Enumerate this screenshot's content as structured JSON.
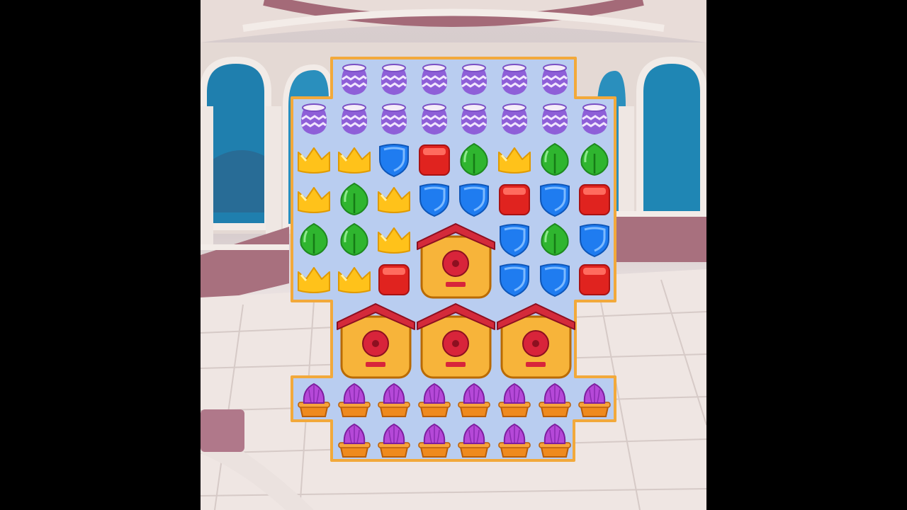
{
  "game": {
    "board": {
      "columns": 8,
      "rows": 10,
      "grid": [
        [
          "none",
          "vase",
          "vase",
          "vase",
          "vase",
          "vase",
          "vase",
          "none"
        ],
        [
          "vase",
          "vase",
          "vase",
          "vase",
          "vase",
          "vase",
          "vase",
          "vase"
        ],
        [
          "crown",
          "crown",
          "shield",
          "cube",
          "leaf",
          "crown",
          "leaf",
          "leaf"
        ],
        [
          "crown",
          "leaf",
          "crown",
          "shield",
          "shield",
          "cube",
          "shield",
          "cube"
        ],
        [
          "leaf",
          "leaf",
          "crown",
          "house",
          "house",
          "shield",
          "leaf",
          "shield"
        ],
        [
          "crown",
          "crown",
          "cube",
          "house",
          "house",
          "shield",
          "shield",
          "cube"
        ],
        [
          "none",
          "house",
          "house",
          "house",
          "house",
          "house",
          "house",
          "none"
        ],
        [
          "none",
          "house",
          "house",
          "house",
          "house",
          "house",
          "house",
          "none"
        ],
        [
          "flower",
          "flower",
          "flower",
          "flower",
          "flower",
          "flower",
          "flower",
          "flower"
        ],
        [
          "none",
          "flower",
          "flower",
          "flower",
          "flower",
          "flower",
          "flower",
          "none"
        ]
      ],
      "big_blockers": [
        {
          "type": "birdhouse",
          "row": 4,
          "col": 3
        },
        {
          "type": "birdhouse",
          "row": 6,
          "col": 1
        },
        {
          "type": "birdhouse",
          "row": 6,
          "col": 3
        },
        {
          "type": "birdhouse",
          "row": 6,
          "col": 5
        }
      ]
    },
    "colors": {
      "board_border": "#f2a93b",
      "board_fill": "#b9cdf0",
      "crown": "#ffc21a",
      "leaf": "#2fb52f",
      "shield": "#1f7cf0",
      "cube": "#e0231f",
      "vase": "#8e5fd8",
      "flower_petal": "#b548d8",
      "pot": "#ef8a1e",
      "birdhouse_roof": "#d42a3a",
      "birdhouse_body": "#f7b43a"
    }
  }
}
